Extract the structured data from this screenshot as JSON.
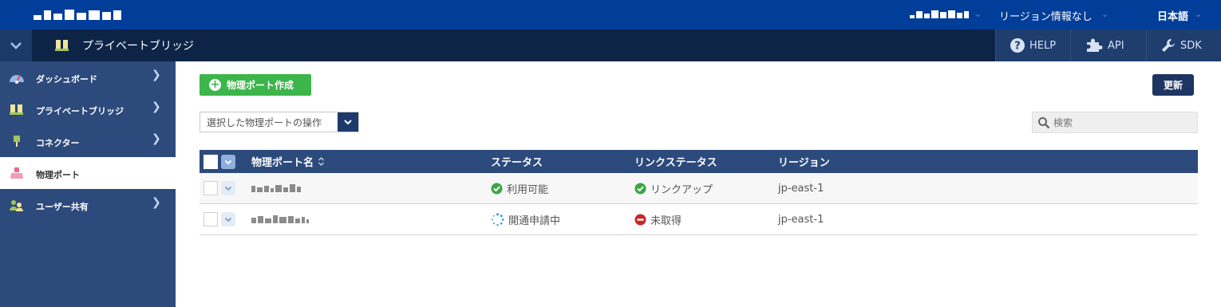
{
  "topbar": {
    "region": "リージョン情報なし",
    "language": "日本語"
  },
  "subbar": {
    "title": "プライベートブリッジ",
    "help": "HELP",
    "api": "API",
    "sdk": "SDK"
  },
  "sidebar": {
    "items": [
      {
        "label": "ダッシュボード",
        "icon": "dashboard-icon"
      },
      {
        "label": "プライベートブリッジ",
        "icon": "bridge-icon"
      },
      {
        "label": "コネクター",
        "icon": "connector-icon"
      },
      {
        "label": "物理ポート",
        "icon": "physical-port-icon"
      },
      {
        "label": "ユーザー共有",
        "icon": "user-share-icon"
      }
    ]
  },
  "toolbar": {
    "create_label": "物理ポート作成",
    "refresh_label": "更新",
    "bulk_action_label": "選択した物理ポートの操作",
    "search_placeholder": "検索"
  },
  "table": {
    "headers": [
      "物理ポート名",
      "ステータス",
      "リンクステータス",
      "リージョン"
    ],
    "rows": [
      {
        "status": "利用可能",
        "status_icon": "check-icon",
        "link_status": "リンクアップ",
        "link_icon": "check-icon",
        "region": "jp-east-1"
      },
      {
        "status": "開通申請中",
        "status_icon": "spinner-icon",
        "link_status": "未取得",
        "link_icon": "no-entry-icon",
        "region": "jp-east-1"
      }
    ]
  },
  "colors": {
    "topbar": "#003e99",
    "subbar": "#0d2447",
    "sidebar": "#2c4a7b",
    "create_button": "#3cb54a",
    "ok_green": "#3aa645",
    "error_red": "#c62828",
    "spinner_blue": "#3aa0e0"
  }
}
